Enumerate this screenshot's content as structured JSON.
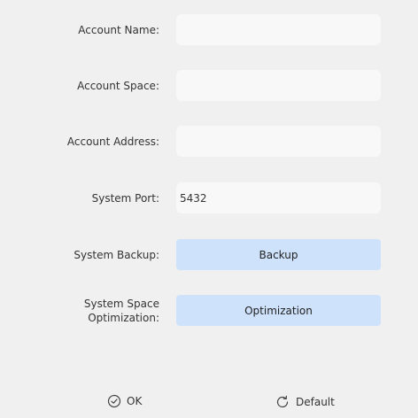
{
  "form": {
    "account_name": {
      "label": "Account Name:",
      "value": ""
    },
    "account_space": {
      "label": "Account Space:",
      "value": ""
    },
    "account_address": {
      "label": "Account Address:",
      "value": ""
    },
    "system_port": {
      "label": "System Port:",
      "value": "5432"
    },
    "system_backup": {
      "label": "System Backup:",
      "button": "Backup"
    },
    "space_optimization": {
      "label_line1": "System Space",
      "label_line2": "Optimization:",
      "button": "Optimization"
    }
  },
  "footer": {
    "ok_label": "OK",
    "default_label": "Default"
  },
  "colors": {
    "background": "#f0f0f0",
    "field": "#f8f8f8",
    "button": "#cfe2fc"
  }
}
